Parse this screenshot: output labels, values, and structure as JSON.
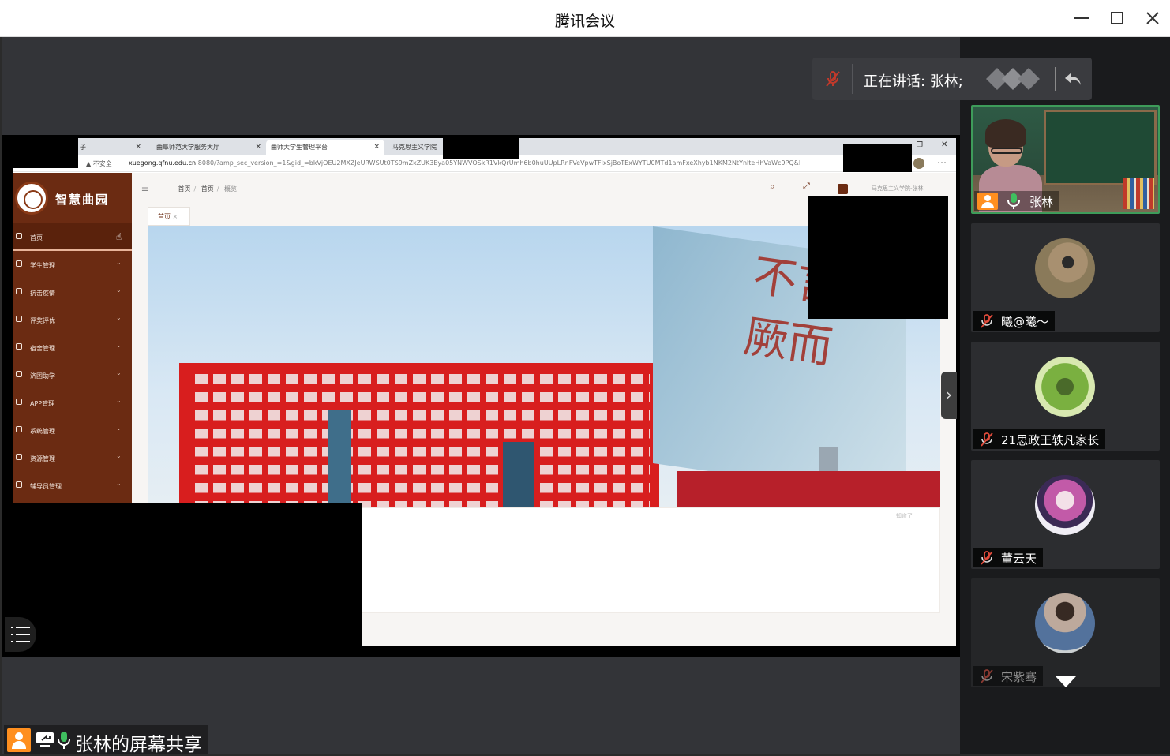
{
  "window": {
    "title": "腾讯会议"
  },
  "speaking": {
    "text": "正在讲话: 张林;"
  },
  "shared_screen": {
    "browser_tabs": [
      {
        "label": "子"
      },
      {
        "label": "曲阜师范大学服务大厅"
      },
      {
        "label": "曲师大学生管理平台"
      },
      {
        "label": "马克思主义学院"
      }
    ],
    "security_label": "不安全",
    "url_host": "xuegong.qfnu.edu.cn",
    "url_rest": ":8080/?amp_sec_version_=1&gid_=bkVjOEU2MXZJeURWSUt0TS9mZkZUK3Eya05YNWVOSkR1VkQrUmh6b0huUUpLRnFVeVpwTFlxSjBoTExWYTU0MTd1amFxeXhyb1NKM2NtYnlteHhVaWc9PQ&EM...",
    "app_logo_text": "智慧曲园",
    "sidebar_items": [
      {
        "label": "首页",
        "icon": "home-icon"
      },
      {
        "label": "学生管理",
        "icon": "user-icon"
      },
      {
        "label": "抗击疫情",
        "icon": "shield-icon"
      },
      {
        "label": "评奖评优",
        "icon": "award-icon"
      },
      {
        "label": "宿舍管理",
        "icon": "building-icon"
      },
      {
        "label": "济困助学",
        "icon": "star-icon"
      },
      {
        "label": "APP管理",
        "icon": "phone-icon"
      },
      {
        "label": "系统管理",
        "icon": "gear-icon"
      },
      {
        "label": "资源管理",
        "icon": "folder-icon"
      },
      {
        "label": "辅导员管理",
        "icon": "people-icon"
      }
    ],
    "breadcrumb": [
      "首页",
      "首页",
      "概览"
    ],
    "user_info": "马克思主义学院-张林",
    "page_tab": "首页",
    "hero_sign_text": "不言 佬人厥而",
    "notice_text": "知道了"
  },
  "participants": [
    {
      "name": "张林",
      "type": "camera",
      "mic": "on"
    },
    {
      "name": "曦@曦～",
      "type": "avatar",
      "mic": "off"
    },
    {
      "name": "21思政王轶凡家长",
      "type": "avatar",
      "mic": "off"
    },
    {
      "name": "董云天",
      "type": "avatar",
      "mic": "off"
    },
    {
      "name": "宋紫骞",
      "type": "avatar",
      "mic": "off",
      "dimmed": true
    }
  ],
  "share_label": "张林的屏幕共享",
  "colors": {
    "accent_green": "#3e9c5a",
    "user_orange": "#ff8f1f",
    "app_brown": "#6b2b12",
    "building_red": "#d81e1e"
  }
}
